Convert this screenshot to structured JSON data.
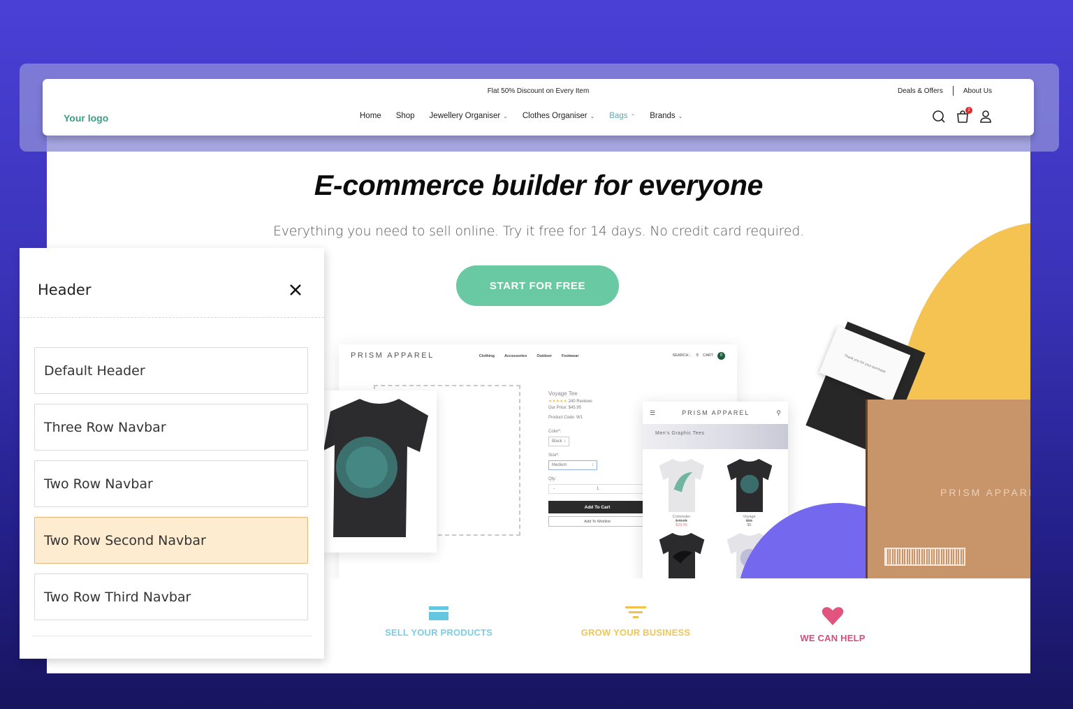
{
  "colors": {
    "accent_green": "#68c9a3",
    "logo_green": "#3a9e84",
    "active_nav": "#5aa9b5",
    "selected_option_bg": "#feecd0",
    "badge_red": "#e0282e",
    "yellow_shape": "#f4c351",
    "purple_shape": "#7468ee"
  },
  "site_header": {
    "promo": "Flat 50% Discount on Every Item",
    "top_links": [
      "Deals & Offers",
      "About Us"
    ],
    "logo": "Your logo",
    "nav": [
      {
        "label": "Home",
        "dropdown": false
      },
      {
        "label": "Shop",
        "dropdown": false
      },
      {
        "label": "Jewellery Organiser",
        "dropdown": true,
        "chevron": "⌄"
      },
      {
        "label": "Clothes Organiser",
        "dropdown": true,
        "chevron": "⌄"
      },
      {
        "label": "Bags",
        "dropdown": true,
        "chevron": "⌃",
        "active": true
      },
      {
        "label": "Brands",
        "dropdown": true,
        "chevron": "⌄"
      }
    ],
    "icons": [
      "search-icon",
      "shopping-bag-icon",
      "user-icon"
    ],
    "cart_count": "2"
  },
  "hero": {
    "title": "E-commerce builder for everyone",
    "subtitle": "Everything you need to sell online. Try it free for 14 days. No credit card required.",
    "cta": "START FOR FREE"
  },
  "desktop_mockup": {
    "brand": "PRISM APPAREL",
    "menu": [
      "Clothing",
      "Accessories",
      "Outdoor",
      "Footwear"
    ],
    "search": "SEARCH...",
    "cart": "CART",
    "cart_count": "0",
    "product": {
      "name": "Voyage Tee",
      "stars": "★★★★★",
      "reviews": "240 Reviews",
      "price": "Our Price: $45.95",
      "code": "Product Code: W1",
      "color_label": "Color*:",
      "color_value": "Black",
      "size_label": "Size*:",
      "size_value": "Medium",
      "qty_label": "Qty:",
      "qty_minus": "-",
      "qty_value": "1",
      "add_to_cart": "Add To Cart",
      "add_to_wishlist": "Add To Wishlist"
    }
  },
  "mobile_mockup": {
    "brand": "PRISM APPAREL",
    "banner": "Men's Graphic Tees",
    "items": [
      {
        "name": "Commuter",
        "old_price": "$49.95",
        "price": "$29.95"
      },
      {
        "name": "Voyage",
        "old_price": "$55",
        "price": "$5"
      }
    ]
  },
  "packaging": {
    "card_text": "Thank you for your purchase",
    "box_text": "PRISM APPARE"
  },
  "features": [
    {
      "label": "SELL YOUR PRODUCTS",
      "icon": "credit-card-icon"
    },
    {
      "label": "GROW YOUR BUSINESS",
      "icon": "funnel-icon"
    },
    {
      "label": "WE CAN HELP",
      "icon": "heart-icon"
    }
  ],
  "panel": {
    "title": "Header",
    "options": [
      {
        "label": "Default Header",
        "selected": false
      },
      {
        "label": "Three Row Navbar",
        "selected": false
      },
      {
        "label": "Two Row Navbar",
        "selected": false
      },
      {
        "label": "Two Row Second Navbar",
        "selected": true
      },
      {
        "label": "Two Row Third Navbar",
        "selected": false
      }
    ]
  }
}
